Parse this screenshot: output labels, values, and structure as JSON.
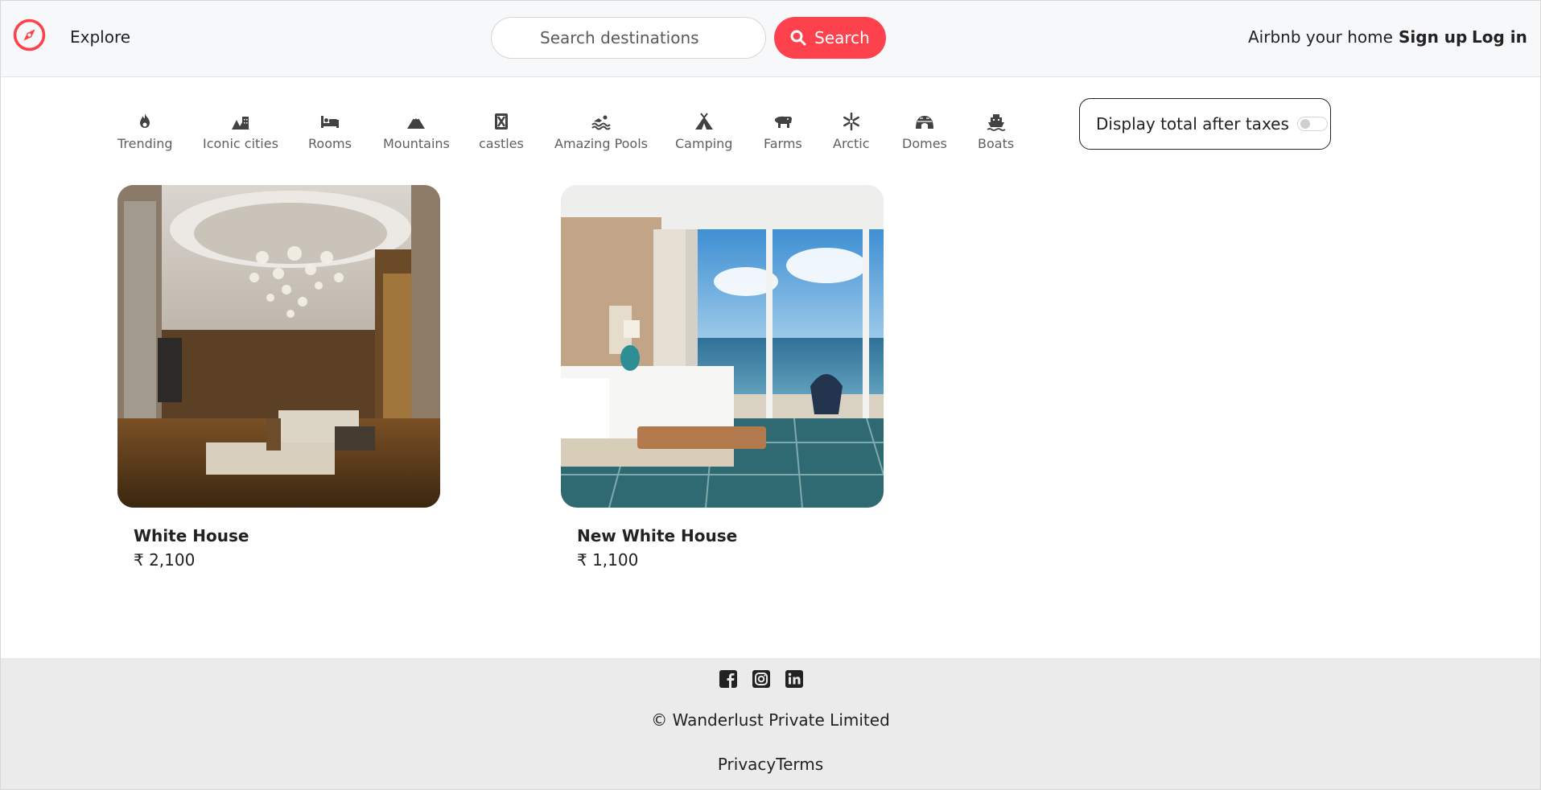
{
  "navbar": {
    "brand_icon": "compass-icon",
    "explore_label": "Explore",
    "search_placeholder": "Search destinations",
    "search_button_label": "Search",
    "host_label": "Airbnb your home",
    "signup_label": "Sign up",
    "login_label": "Log in",
    "accent_color": "#fe424d"
  },
  "filters": [
    {
      "label": "Trending",
      "icon": "fire-icon"
    },
    {
      "label": "Iconic cities",
      "icon": "city-icon"
    },
    {
      "label": "Rooms",
      "icon": "bed-icon"
    },
    {
      "label": "Mountains",
      "icon": "mountain-icon"
    },
    {
      "label": "castles",
      "icon": "castle-icon"
    },
    {
      "label": "Amazing Pools",
      "icon": "swimmer-icon"
    },
    {
      "label": "Camping",
      "icon": "tent-icon"
    },
    {
      "label": "Farms",
      "icon": "cow-icon"
    },
    {
      "label": "Arctic",
      "icon": "snowflake-icon"
    },
    {
      "label": "Domes",
      "icon": "igloo-icon"
    },
    {
      "label": "Boats",
      "icon": "ship-icon"
    }
  ],
  "tax_toggle": {
    "label": "Display total after taxes",
    "checked": false
  },
  "listings": [
    {
      "title": "White House",
      "price": "₹ 2,100",
      "image": "hotel-suite-chandelier-photo"
    },
    {
      "title": "New White House",
      "price": "₹ 1,100",
      "image": "ocean-view-bedroom-photo"
    }
  ],
  "footer": {
    "socials": [
      "facebook-icon",
      "instagram-icon",
      "linkedin-icon"
    ],
    "copyright": "© Wanderlust Private Limited",
    "privacy_label": "Privacy",
    "terms_label": "Terms"
  }
}
